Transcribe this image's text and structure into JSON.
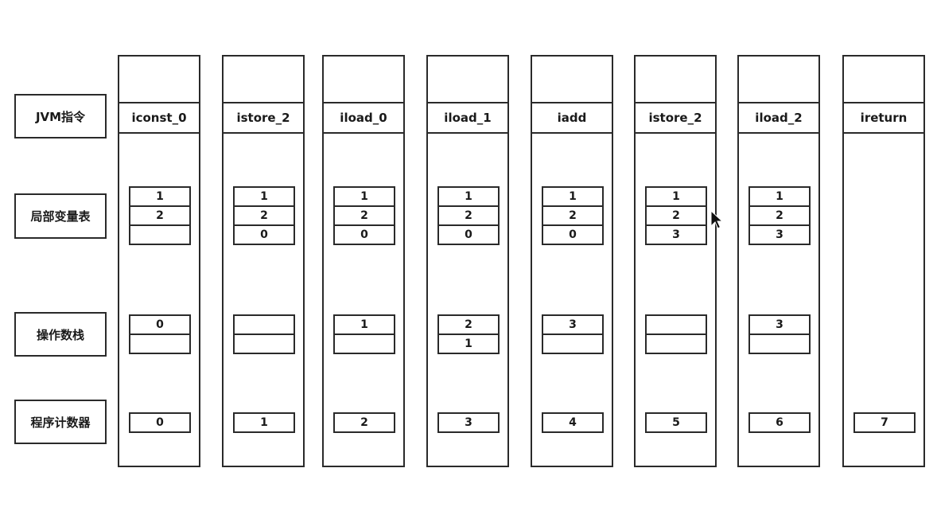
{
  "labels": {
    "instruction": "JVM指令",
    "local_vars": "局部变量表",
    "operand_stack": "操作数栈",
    "pc": "程序计数器"
  },
  "steps": [
    {
      "instr": "iconst_0",
      "vars": [
        "1",
        "2",
        ""
      ],
      "ops": [
        "0",
        ""
      ],
      "pc": "0"
    },
    {
      "instr": "istore_2",
      "vars": [
        "1",
        "2",
        "0"
      ],
      "ops": [
        "",
        ""
      ],
      "pc": "1"
    },
    {
      "instr": "iload_0",
      "vars": [
        "1",
        "2",
        "0"
      ],
      "ops": [
        "1",
        ""
      ],
      "pc": "2"
    },
    {
      "instr": "iload_1",
      "vars": [
        "1",
        "2",
        "0"
      ],
      "ops": [
        "2",
        "1"
      ],
      "pc": "3"
    },
    {
      "instr": "iadd",
      "vars": [
        "1",
        "2",
        "0"
      ],
      "ops": [
        "3",
        ""
      ],
      "pc": "4"
    },
    {
      "instr": "istore_2",
      "vars": [
        "1",
        "2",
        "3"
      ],
      "ops": [
        "",
        ""
      ],
      "pc": "5"
    },
    {
      "instr": "iload_2",
      "vars": [
        "1",
        "2",
        "3"
      ],
      "ops": [
        "3",
        ""
      ],
      "pc": "6"
    },
    {
      "instr": "ireturn",
      "vars": null,
      "ops": null,
      "pc": "7"
    }
  ]
}
